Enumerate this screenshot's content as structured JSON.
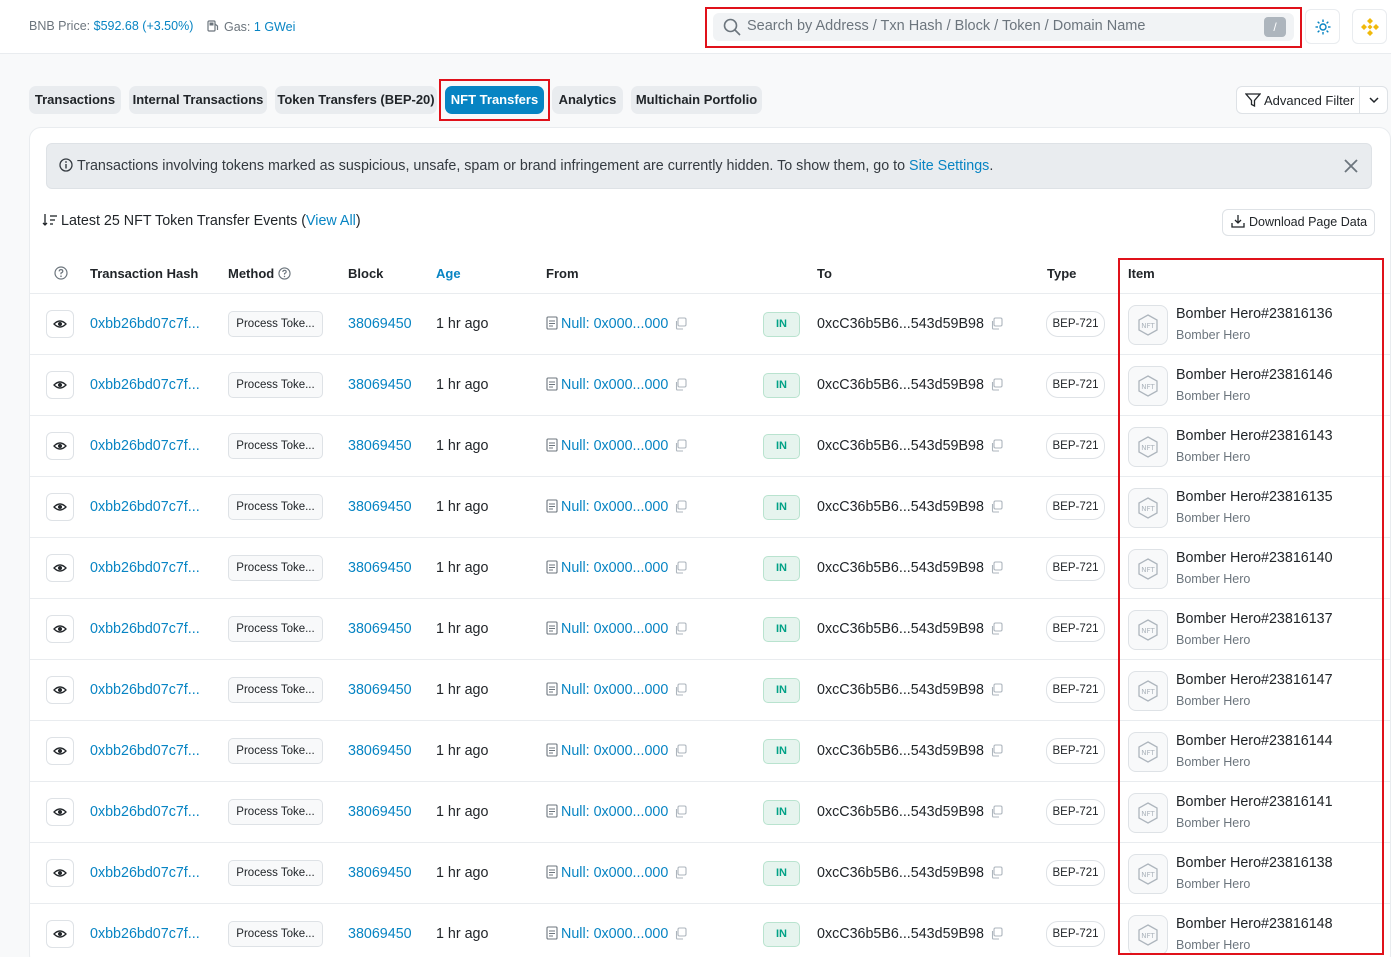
{
  "header": {
    "bnb_price_label": "BNB Price:",
    "bnb_price_value": "$592.68 (+3.50%)",
    "gas_label": "Gas:",
    "gas_value": "1 GWei",
    "search_placeholder": "Search by Address / Txn Hash / Block / Token / Domain Name",
    "search_shortcut": "/"
  },
  "tabs": [
    {
      "label": "Transactions"
    },
    {
      "label": "Internal Transactions"
    },
    {
      "label": "Token Transfers (BEP-20)"
    },
    {
      "label": "NFT Transfers"
    },
    {
      "label": "Analytics"
    },
    {
      "label": "Multichain Portfolio"
    }
  ],
  "advanced_filter_label": "Advanced Filter",
  "alert": {
    "text": "Transactions involving tokens marked as suspicious, unsafe, spam or brand infringement are currently hidden. To show them, go to ",
    "link": "Site Settings",
    "end": "."
  },
  "summary": {
    "text": "Latest 25 NFT Token Transfer Events (",
    "link": "View All",
    "end": ")"
  },
  "download_label": "Download Page Data",
  "columns": {
    "hash": "Transaction Hash",
    "method": "Method",
    "block": "Block",
    "age": "Age",
    "from": "From",
    "to": "To",
    "type": "Type",
    "item": "Item"
  },
  "rows": [
    {
      "hash": "0xbb26bd07c7f...",
      "method": "Process Toke...",
      "block": "38069450",
      "age": "1 hr ago",
      "from": "Null: 0x000...000",
      "direction": "IN",
      "to": "0xcC36b5B6...543d59B98",
      "type": "BEP-721",
      "item_name": "Bomber Hero#23816136",
      "item_collection": "Bomber Hero"
    },
    {
      "hash": "0xbb26bd07c7f...",
      "method": "Process Toke...",
      "block": "38069450",
      "age": "1 hr ago",
      "from": "Null: 0x000...000",
      "direction": "IN",
      "to": "0xcC36b5B6...543d59B98",
      "type": "BEP-721",
      "item_name": "Bomber Hero#23816146",
      "item_collection": "Bomber Hero"
    },
    {
      "hash": "0xbb26bd07c7f...",
      "method": "Process Toke...",
      "block": "38069450",
      "age": "1 hr ago",
      "from": "Null: 0x000...000",
      "direction": "IN",
      "to": "0xcC36b5B6...543d59B98",
      "type": "BEP-721",
      "item_name": "Bomber Hero#23816143",
      "item_collection": "Bomber Hero"
    },
    {
      "hash": "0xbb26bd07c7f...",
      "method": "Process Toke...",
      "block": "38069450",
      "age": "1 hr ago",
      "from": "Null: 0x000...000",
      "direction": "IN",
      "to": "0xcC36b5B6...543d59B98",
      "type": "BEP-721",
      "item_name": "Bomber Hero#23816135",
      "item_collection": "Bomber Hero"
    },
    {
      "hash": "0xbb26bd07c7f...",
      "method": "Process Toke...",
      "block": "38069450",
      "age": "1 hr ago",
      "from": "Null: 0x000...000",
      "direction": "IN",
      "to": "0xcC36b5B6...543d59B98",
      "type": "BEP-721",
      "item_name": "Bomber Hero#23816140",
      "item_collection": "Bomber Hero"
    },
    {
      "hash": "0xbb26bd07c7f...",
      "method": "Process Toke...",
      "block": "38069450",
      "age": "1 hr ago",
      "from": "Null: 0x000...000",
      "direction": "IN",
      "to": "0xcC36b5B6...543d59B98",
      "type": "BEP-721",
      "item_name": "Bomber Hero#23816137",
      "item_collection": "Bomber Hero"
    },
    {
      "hash": "0xbb26bd07c7f...",
      "method": "Process Toke...",
      "block": "38069450",
      "age": "1 hr ago",
      "from": "Null: 0x000...000",
      "direction": "IN",
      "to": "0xcC36b5B6...543d59B98",
      "type": "BEP-721",
      "item_name": "Bomber Hero#23816147",
      "item_collection": "Bomber Hero"
    },
    {
      "hash": "0xbb26bd07c7f...",
      "method": "Process Toke...",
      "block": "38069450",
      "age": "1 hr ago",
      "from": "Null: 0x000...000",
      "direction": "IN",
      "to": "0xcC36b5B6...543d59B98",
      "type": "BEP-721",
      "item_name": "Bomber Hero#23816144",
      "item_collection": "Bomber Hero"
    },
    {
      "hash": "0xbb26bd07c7f...",
      "method": "Process Toke...",
      "block": "38069450",
      "age": "1 hr ago",
      "from": "Null: 0x000...000",
      "direction": "IN",
      "to": "0xcC36b5B6...543d59B98",
      "type": "BEP-721",
      "item_name": "Bomber Hero#23816141",
      "item_collection": "Bomber Hero"
    },
    {
      "hash": "0xbb26bd07c7f...",
      "method": "Process Toke...",
      "block": "38069450",
      "age": "1 hr ago",
      "from": "Null: 0x000...000",
      "direction": "IN",
      "to": "0xcC36b5B6...543d59B98",
      "type": "BEP-721",
      "item_name": "Bomber Hero#23816138",
      "item_collection": "Bomber Hero"
    },
    {
      "hash": "0xbb26bd07c7f...",
      "method": "Process Toke...",
      "block": "38069450",
      "age": "1 hr ago",
      "from": "Null: 0x000...000",
      "direction": "IN",
      "to": "0xcC36b5B6...543d59B98",
      "type": "BEP-721",
      "item_name": "Bomber Hero#23816148",
      "item_collection": "Bomber Hero"
    }
  ],
  "icons": [
    "gas-pump-icon",
    "search-icon",
    "theme-sun-icon",
    "bnb-logo-icon",
    "filter-icon",
    "chevron-down-icon",
    "info-icon",
    "close-icon",
    "sort-icon",
    "download-icon",
    "question-icon",
    "eye-icon",
    "contract-icon",
    "copy-icon",
    "nft-icon"
  ],
  "colors": {
    "accent": "#0784c3",
    "in_badge": "#00a186",
    "highlight": "#e0111a"
  }
}
